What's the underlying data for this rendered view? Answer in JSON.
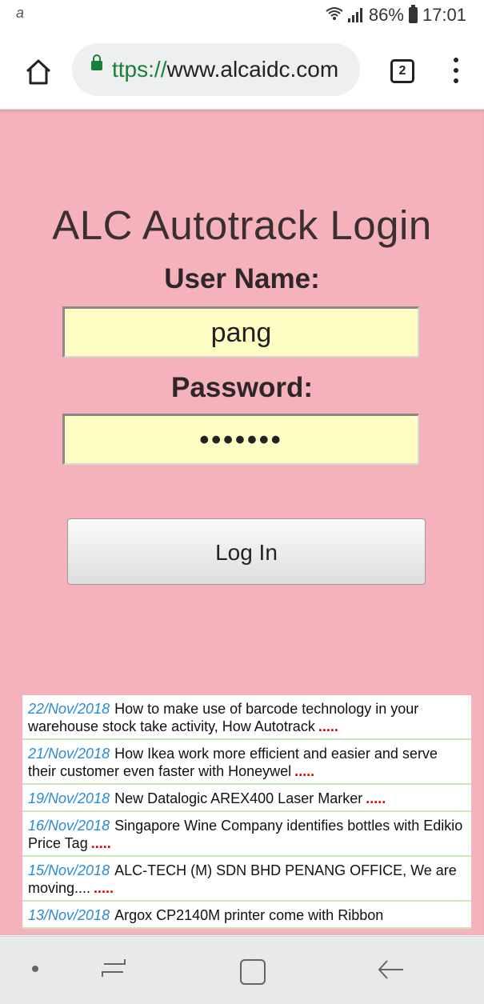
{
  "status_bar": {
    "carrier_icon": "a-logo-icon",
    "battery_percent": "86%",
    "time": "17:01"
  },
  "browser": {
    "url_scheme": "ttps://",
    "url_host": "www.alcaidc.com",
    "tab_count": "2"
  },
  "login": {
    "title": "ALC Autotrack Login",
    "username_label": "User Name:",
    "username_value": "pang",
    "password_label": "Password:",
    "password_value": "•••••••",
    "login_button": "Log In"
  },
  "news": [
    {
      "date": "22/Nov/2018",
      "text": "How to make use of barcode technology in your warehouse stock take activity, How Autotrack",
      "more": "....."
    },
    {
      "date": "21/Nov/2018",
      "text": "How Ikea work more efficient and easier and serve their customer even faster with Honeywel",
      "more": "....."
    },
    {
      "date": "19/Nov/2018",
      "text": "New Datalogic AREX400 Laser Marker",
      "more": "....."
    },
    {
      "date": "16/Nov/2018",
      "text": "Singapore Wine Company identifies bottles with Edikio Price Tag",
      "more": "....."
    },
    {
      "date": "15/Nov/2018",
      "text": "ALC-TECH (M) SDN BHD PENANG OFFICE, We are moving....",
      "more": "....."
    },
    {
      "date": "13/Nov/2018",
      "text": "Argox CP2140M printer come with Ribbon",
      "more": ""
    }
  ],
  "colors": {
    "page_background": "#f6b2bb",
    "input_background": "#fefec4",
    "news_date": "#2a8ad4",
    "news_more": "#e00000",
    "secure_green": "#188038"
  }
}
